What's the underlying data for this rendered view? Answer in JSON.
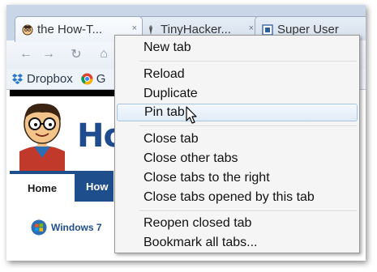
{
  "tabs": [
    {
      "title": "the How-T...",
      "favicon": "howtogeek-icon",
      "close": "×"
    },
    {
      "title": "TinyHacker...",
      "favicon": "tinyhacker-icon",
      "close": "×"
    },
    {
      "title": "Super User",
      "favicon": "superuser-icon"
    }
  ],
  "toolbar": {
    "back_icon": "←",
    "forward_icon": "→",
    "reload_icon": "↻",
    "home_icon": "⌂"
  },
  "bookmarks": [
    {
      "label": "Dropbox",
      "icon": "dropbox-icon"
    },
    {
      "label": "G",
      "icon": "chrome-icon"
    }
  ],
  "page": {
    "logo_text": "How",
    "nav": {
      "home": "Home",
      "next": "How"
    },
    "category": "Windows 7"
  },
  "context_menu": {
    "items": [
      {
        "label": "New tab"
      },
      {
        "label": "Reload"
      },
      {
        "label": "Duplicate"
      },
      {
        "label": "Pin tab",
        "highlighted": true
      },
      {
        "label": "Close tab"
      },
      {
        "label": "Close other tabs"
      },
      {
        "label": "Close tabs to the right"
      },
      {
        "label": "Close tabs opened by this tab"
      },
      {
        "label": "Reopen closed tab"
      },
      {
        "label": "Bookmark all tabs..."
      }
    ]
  },
  "colors": {
    "frame": "#c9d6e8",
    "site_blue": "#1f4e8c",
    "menu_bg": "#f5f5f5",
    "highlight_border": "#a9c3e3"
  }
}
